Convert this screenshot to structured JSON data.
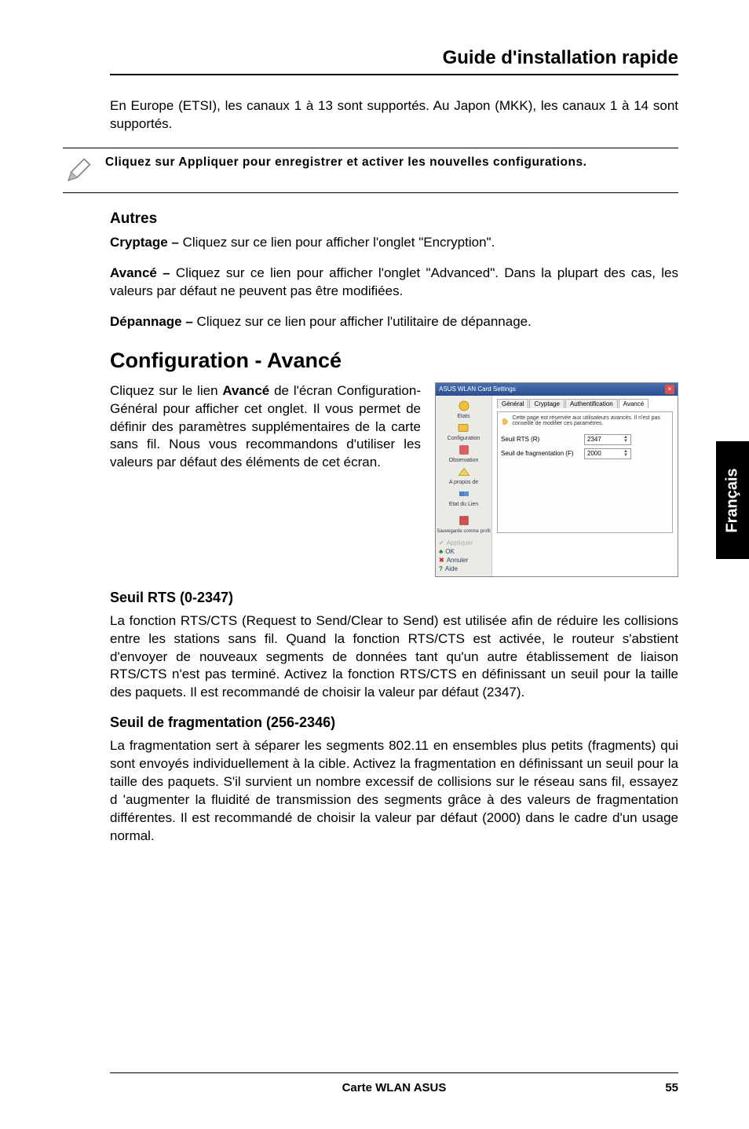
{
  "header": {
    "title": "Guide d'installation rapide"
  },
  "intro": "En Europe (ETSI), les canaux 1 à 13 sont supportés. Au Japon (MKK), les canaux 1 à 14 sont supportés.",
  "note": "Cliquez sur Appliquer pour enregistrer et activer les nouvelles configurations.",
  "autres": {
    "heading": "Autres",
    "cryptage_label": "Cryptage  –",
    "cryptage_text": " Cliquez sur ce lien pour afficher l'onglet  \"Encryption\".",
    "avance_label": "Avancé –",
    "avance_text": " Cliquez sur ce lien pour afficher l'onglet \"Advanced\". Dans la plupart des cas, les valeurs par défaut ne peuvent pas être modifiées.",
    "depannage_label": "Dépannage –",
    "depannage_text": " Cliquez sur ce lien pour afficher l'utilitaire de dépannage."
  },
  "config": {
    "heading": "Configuration - Avancé",
    "intro_pre": "Cliquez sur le lien ",
    "intro_bold": "Avancé",
    "intro_post": " de l'écran Configuration-Général pour afficher cet onglet. Il vous permet de définir des paramètres supplémentaires de la carte sans fil. Nous vous recommandons d'utiliser les valeurs par défaut des éléments de cet écran."
  },
  "screenshot": {
    "title": "ASUS WLAN Card Settings",
    "tabs": [
      "Général",
      "Cryptage",
      "Authentification",
      "Avancé"
    ],
    "warn": "Cette page est réservée aux utilisateurs avancés. Il n'est pas conseillé de modifier ces paramètres.",
    "row1_label": "Seuil RTS (R)",
    "row1_value": "2347",
    "row2_label": "Seuil de fragmentation (F)",
    "row2_value": "2000",
    "side": {
      "etats": "Etats",
      "configuration": "Configuration",
      "observation": "Observation",
      "apropos": "A propos de",
      "etatlien": "Etat du Lien",
      "sauvegarde": "Sauvegarde comme profil",
      "appliquer": "Appliquer",
      "ok": "OK",
      "annuler": "Annuler",
      "aide": "Aide"
    }
  },
  "rts": {
    "heading": "Seuil RTS (0-2347)",
    "text": "La fonction RTS/CTS (Request to Send/Clear to Send) est utilisée afin de réduire les collisions entre les stations sans fil. Quand la fonction RTS/CTS est activée, le routeur s'abstient d'envoyer de nouveaux segments de données tant qu'un autre établissement de liaison RTS/CTS n'est pas terminé. Activez la fonction RTS/CTS en définissant un seuil pour la taille des paquets. Il est recommandé de choisir la valeur par défaut  (2347)."
  },
  "frag": {
    "heading": "Seuil de fragmentation (256-2346)",
    "text": "La fragmentation sert à séparer les segments 802.11 en ensembles plus petits (fragments) qui sont envoyés individuellement à la cible. Activez la fragmentation en définissant un seuil pour la taille des paquets. S'il survient un nombre excessif de collisions sur le réseau sans fil, essayez d 'augmenter la fluidité de transmission des segments grâce à des valeurs de fragmentation différentes. Il est recommandé de choisir la valeur par défaut (2000) dans le cadre d'un usage normal."
  },
  "side_tab": "Français",
  "footer": {
    "center": "Carte WLAN ASUS",
    "page": "55"
  }
}
